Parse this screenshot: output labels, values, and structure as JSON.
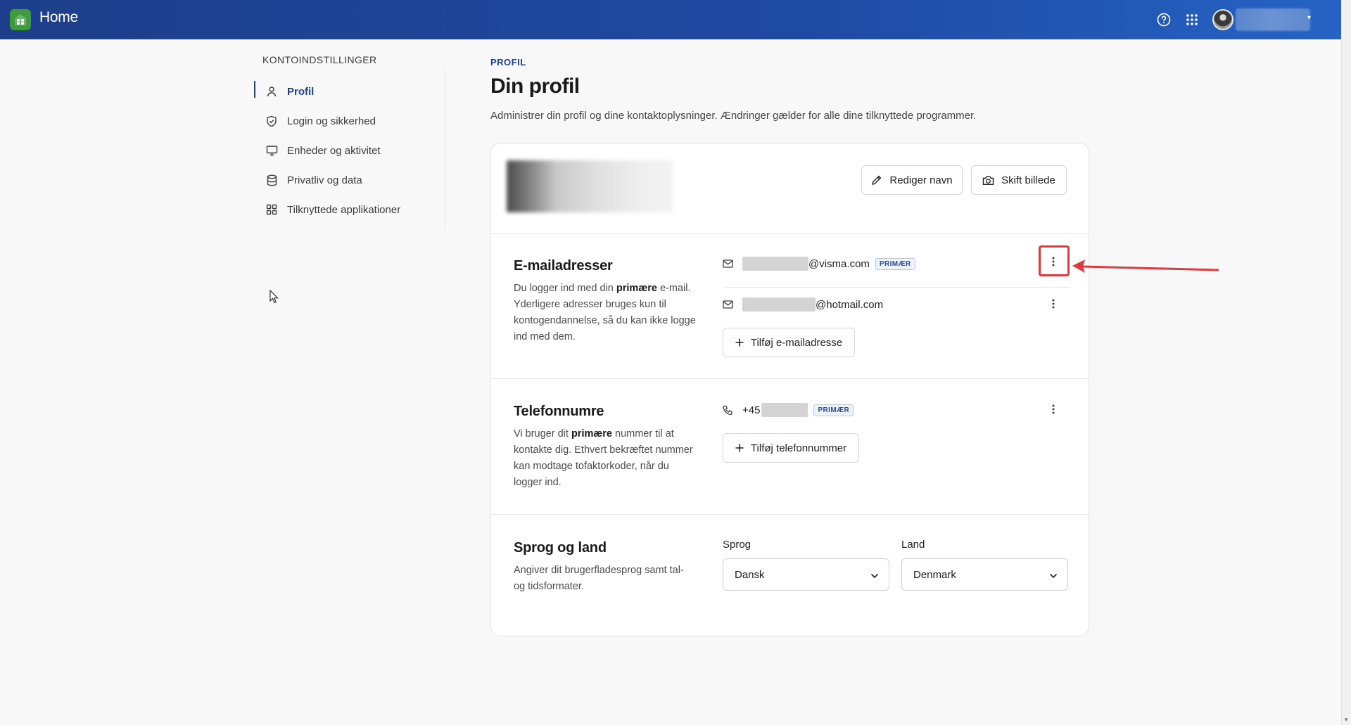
{
  "topbar": {
    "title": "Home",
    "help_icon": "help-circle-icon",
    "apps_icon": "grid-dots-icon",
    "brand_color": "#1f4aa3"
  },
  "sidebar": {
    "heading": "KONTOINDSTILLINGER",
    "items": [
      {
        "label": "Profil",
        "icon": "person-icon",
        "active": true
      },
      {
        "label": "Login og sikkerhed",
        "icon": "shield-icon",
        "active": false
      },
      {
        "label": "Enheder og aktivitet",
        "icon": "monitor-icon",
        "active": false
      },
      {
        "label": "Privatliv og data",
        "icon": "database-icon",
        "active": false
      },
      {
        "label": "Tilknyttede applikationer",
        "icon": "apps-grid-icon",
        "active": false
      }
    ]
  },
  "main": {
    "breadcrumb": "PROFIL",
    "title": "Din profil",
    "description": "Administrer din profil og dine kontaktoplysninger. Ændringer gælder for alle dine tilknyttede programmer.",
    "buttons": {
      "edit_name": "Rediger navn",
      "change_picture": "Skift billede"
    },
    "email": {
      "title": "E-mailadresser",
      "desc_before": "Du logger ind med din ",
      "desc_bold": "primære",
      "desc_after": " e-mail. Yderligere adresser bruges kun til kontogendannelse, så du kan ikke logge ind med dem.",
      "entries": [
        {
          "suffix": "@visma.com",
          "badge": "PRIMÆR"
        },
        {
          "suffix": "@hotmail.com",
          "badge": ""
        }
      ],
      "add_label": "Tilføj e-mailadresse"
    },
    "phone": {
      "title": "Telefonnumre",
      "desc_before": "Vi bruger dit ",
      "desc_bold": "primære",
      "desc_after": " nummer til at kontakte dig. Ethvert bekræftet nummer kan modtage tofaktorkoder, når du logger ind.",
      "entries": [
        {
          "prefix": "+45",
          "badge": "PRIMÆR"
        }
      ],
      "add_label": "Tilføj telefonnummer"
    },
    "locale": {
      "title": "Sprog og land",
      "desc": "Angiver dit brugerfladesprog samt tal- og tidsformater.",
      "language_label": "Sprog",
      "language_value": "Dansk",
      "country_label": "Land",
      "country_value": "Denmark"
    }
  },
  "annotation": {
    "highlight_color": "#e0393e"
  }
}
